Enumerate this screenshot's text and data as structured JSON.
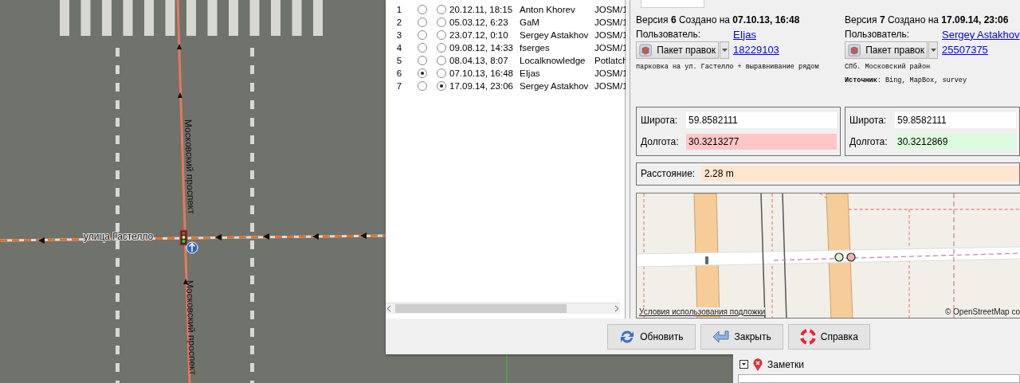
{
  "map_canvas": {
    "street_labels": [
      {
        "text": "Московский проспект"
      },
      {
        "text": "Московский проспект"
      },
      {
        "text": "улица Гастелло"
      }
    ]
  },
  "history_dialog": {
    "history_table": {
      "rows": [
        {
          "number": "1",
          "reference_selected": false,
          "current_selected": false,
          "date": "20.12.11, 18:15",
          "user": "Anton Khorev",
          "editor": "JOSM/1"
        },
        {
          "number": "2",
          "reference_selected": false,
          "current_selected": false,
          "date": "05.03.12, 6:23",
          "user": "GaM",
          "editor": "JOSM/1"
        },
        {
          "number": "3",
          "reference_selected": false,
          "current_selected": false,
          "date": "23.07.12, 0:10",
          "user": "Sergey Astakhov",
          "editor": "JOSM/1"
        },
        {
          "number": "4",
          "reference_selected": false,
          "current_selected": false,
          "date": "09.08.12, 14:33",
          "user": "fserges",
          "editor": "JOSM/1"
        },
        {
          "number": "5",
          "reference_selected": false,
          "current_selected": false,
          "date": "08.04.13, 8:07",
          "user": "Localknowledge",
          "editor": "Potlatch"
        },
        {
          "number": "6",
          "reference_selected": true,
          "current_selected": false,
          "date": "07.10.13, 16:48",
          "user": "EIjas",
          "editor": "JOSM/1"
        },
        {
          "number": "7",
          "reference_selected": false,
          "current_selected": true,
          "date": "17.09.14, 23:06",
          "user": "Sergey Astakhov",
          "editor": "JOSM/1"
        }
      ]
    },
    "versions": [
      {
        "heading": "Версия **6** Создано на **07.10.13, 16:48**",
        "user_label": "Пользователь:",
        "user": "EIjas",
        "changeset_button": "Пакет правок",
        "changeset_id": "18229103",
        "comment": "парковка на ул. Гастелло + выравнивание рядом"
      },
      {
        "heading": "Версия **7** Создано на **17.09.14, 23:06**",
        "user_label": "Пользователь:",
        "user": "Sergey Astakhov",
        "changeset_button": "Пакет правок",
        "changeset_id": "25507375",
        "comment": "СПб. Московский район",
        "source": "**Источник**: Bing, MapBox, survey"
      }
    ],
    "coordinates": [
      {
        "rows": [
          {
            "label": "Широта:",
            "value": "59.8582111",
            "color": "#ffffff"
          },
          {
            "label": "Долгота:",
            "value": "30.3213277",
            "color": "#ffc6c6"
          }
        ]
      },
      {
        "rows": [
          {
            "label": "Широта:",
            "value": "59.8582111",
            "color": "#ffffff"
          },
          {
            "label": "Долгота:",
            "value": "30.3212869",
            "color": "#ddfcdd"
          }
        ]
      }
    ],
    "distance": {
      "label": "Расстояние:",
      "value": "2.28 m"
    },
    "mini_map": {
      "terms_link": "Условия использования подложки",
      "attribution": "© OpenStreetMap co"
    },
    "buttons": [
      {
        "label": "Обновить",
        "kind": "refresh"
      },
      {
        "label": "Закрыть",
        "kind": "close"
      },
      {
        "label": "Справка",
        "kind": "help"
      }
    ]
  },
  "notes_panel": {
    "title": "Заметки"
  }
}
